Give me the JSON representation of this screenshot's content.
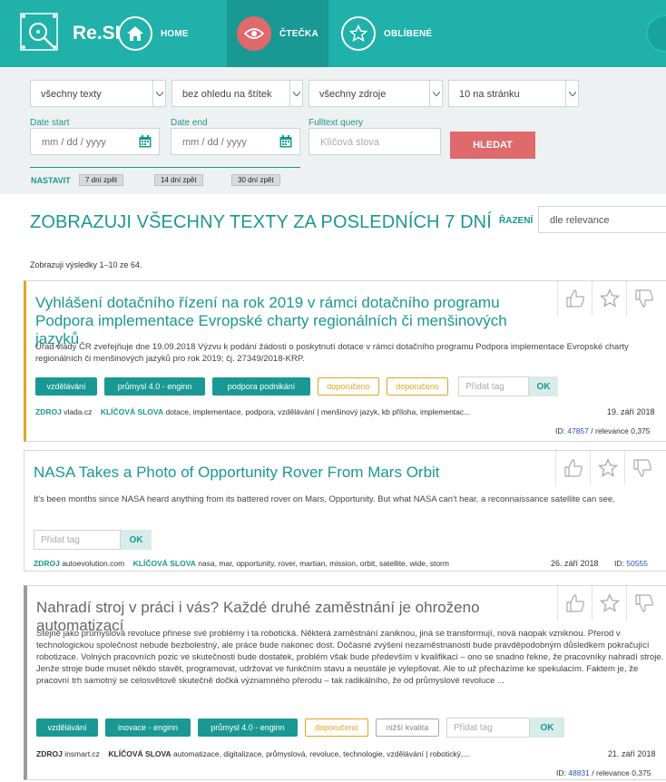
{
  "app": {
    "name": "Re.SI"
  },
  "nav": [
    {
      "label": "HOME",
      "icon": "home-icon"
    },
    {
      "label": "ČTEČKA",
      "icon": "eye-icon"
    },
    {
      "label": "OBLÍBENÉ",
      "icon": "star-icon"
    }
  ],
  "filters": {
    "text_type": "všechny texty",
    "tag_filter": "bez ohledu na štítek",
    "sources": "všechny zdroje",
    "per_page": "10 na stránku",
    "date_start_label": "Date start",
    "date_end_label": "Date end",
    "fulltext_label": "Fulltext query",
    "date_placeholder": "mm / dd / yyyy",
    "fulltext_placeholder": "Klíčová slova",
    "search_button": "HLEDAT",
    "presets_label": "NASTAVIT",
    "presets": [
      "7 dní zpět",
      "14 dní zpět",
      "30 dní zpět"
    ]
  },
  "heading": "ZOBRAZUJI VŠECHNY TEXTY ZA POSLEDNÍCH 7 DNÍ",
  "sort": {
    "label": "ŘAZENÍ",
    "value": "dle relevance"
  },
  "results_count": "Zobrazuji výsledky 1–10 ze 64.",
  "labels": {
    "source": "ZDROJ",
    "keywords": "KLÍČOVÁ SLOVA",
    "tag_placeholder": "Přidat tag",
    "ok": "OK",
    "id_prefix": "ID:",
    "relevance_prefix": "/ relevance"
  },
  "cards": [
    {
      "title": "Vyhlášení dotačního řízení na rok 2019 v rámci dotačního programu Podpora implementace Evropské charty regionálních či menšinových jazyků",
      "description": "Úřad vlády ČR zveřejňuje dne 19.09.2018 Výzvu k podání žádosti o poskytnutí dotace v rámci dotačního programu Podpora implementace Evropské charty regionálních či menšinových jazyků pro rok 2019; čj. 27349/2018-KRP.",
      "tags": [
        {
          "label": "vzdělávání",
          "style": "teal"
        },
        {
          "label": "průmysl 4.0 - enginn",
          "style": "teal"
        },
        {
          "label": "podpora podnikání",
          "style": "teal"
        },
        {
          "label": "doporučeno",
          "style": "orange"
        },
        {
          "label": "doporučeno",
          "style": "orange"
        }
      ],
      "source": "vlada.cz",
      "keywords": "dotace, implementace, podpora, vzdělávání | menšinový jazyk, kb příloha, implementac...",
      "date": "19. září 2018",
      "id": "47857",
      "relevance": "0,375"
    },
    {
      "title": "NASA Takes a Photo of Opportunity Rover From Mars Orbit",
      "description": "It's been months since NASA heard anything from its battered rover on Mars, Opportunity. But what NASA can't hear, a reconnaissance satellite can see.",
      "tags": [],
      "source": "autoevolution.com",
      "keywords": "nasa, mar, opportunity, rover, martian, mission, orbit, satellite, wide, storm",
      "date": "26. září 2018",
      "id": "50555",
      "relevance": ""
    },
    {
      "title": "Nahradí stroj v práci i vás? Každé druhé zaměstnání je ohroženo automatizací",
      "description": "Stejně jako průmyslová revoluce přinese své problémy i ta robotická. Některá zaměstnání zaniknou, jiná se transformují, nová naopak vzniknou. Přerod v technologickou společnost nebude bezbolestný, ale práce bude nakonec dost. Dočasné zvýšení nezaměstnanosti bude pravděpodobným důsledkem pokračující robotizace. Volných pracovních pozic ve skutečnosti bude dostatek, problém však bude především v kvalifikaci – ono se snadno řekne, že pracovníky nahradí stroje. Jenže stroje bude muset někdo stavět, programovat, udržovat ve funkčním stavu a neustále je vylepšovat. Ale to už přecházíme ke spekulacím. Faktem je, že pracovní trh samotný se celosvětově skutečně dočká významného přerodu – tak radikálního, že od průmyslové revoluce ...",
      "tags": [
        {
          "label": "vzdělávání",
          "style": "teal"
        },
        {
          "label": "inovace - enginn",
          "style": "teal"
        },
        {
          "label": "průmysl 4.0 - enginn",
          "style": "teal"
        },
        {
          "label": "doporučeno",
          "style": "orange"
        },
        {
          "label": "nižší kvalita",
          "style": "grey"
        }
      ],
      "source": "insmart.cz",
      "keywords": "automatizace, digitalizace, průmyslová, revoluce, technologie, vzdělávání | robotický,...",
      "date": "21. září 2018",
      "id": "48831",
      "relevance": "0,375"
    }
  ],
  "colors": {
    "primary": "#1fb1aa",
    "primary_dark": "#1a9893",
    "accent": "#e0696b",
    "gold": "#e5a520"
  }
}
